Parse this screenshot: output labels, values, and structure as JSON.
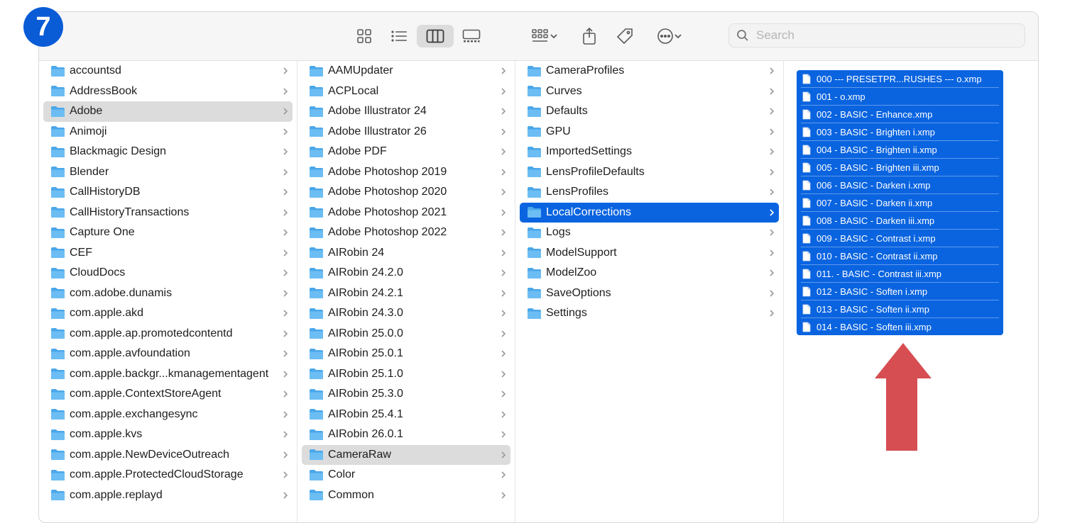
{
  "step_badge": "7",
  "toolbar": {
    "search_placeholder": "Search"
  },
  "columns": {
    "col1": [
      "accountsd",
      "AddressBook",
      "Adobe",
      "Animoji",
      "Blackmagic Design",
      "Blender",
      "CallHistoryDB",
      "CallHistoryTransactions",
      "Capture One",
      "CEF",
      "CloudDocs",
      "com.adobe.dunamis",
      "com.apple.akd",
      "com.apple.ap.promotedcontentd",
      "com.apple.avfoundation",
      "com.apple.backgr...kmanagementagent",
      "com.apple.ContextStoreAgent",
      "com.apple.exchangesync",
      "com.apple.kvs",
      "com.apple.NewDeviceOutreach",
      "com.apple.ProtectedCloudStorage",
      "com.apple.replayd"
    ],
    "col1_selected": "Adobe",
    "col2": [
      "AAMUpdater",
      "ACPLocal",
      "Adobe Illustrator 24",
      "Adobe Illustrator 26",
      "Adobe PDF",
      "Adobe Photoshop 2019",
      "Adobe Photoshop 2020",
      "Adobe Photoshop 2021",
      "Adobe Photoshop 2022",
      "AIRobin 24",
      "AIRobin 24.2.0",
      "AIRobin 24.2.1",
      "AIRobin 24.3.0",
      "AIRobin 25.0.0",
      "AIRobin 25.0.1",
      "AIRobin 25.1.0",
      "AIRobin 25.3.0",
      "AIRobin 25.4.1",
      "AIRobin 26.0.1",
      "CameraRaw",
      "Color",
      "Common"
    ],
    "col2_selected": "CameraRaw",
    "col3": [
      "CameraProfiles",
      "Curves",
      "Defaults",
      "GPU",
      "ImportedSettings",
      "LensProfileDefaults",
      "LensProfiles",
      "LocalCorrections",
      "Logs",
      "ModelSupport",
      "ModelZoo",
      "SaveOptions",
      "Settings"
    ],
    "col3_selected": "LocalCorrections",
    "files": [
      "000 --- PRESETPR...RUSHES --- o.xmp",
      "001 - o.xmp",
      "002 - BASIC - Enhance.xmp",
      "003 - BASIC - Brighten i.xmp",
      "004 - BASIC - Brighten ii.xmp",
      "005 - BASIC - Brighten iii.xmp",
      "006 - BASIC - Darken i.xmp",
      "007 - BASIC - Darken ii.xmp",
      "008 - BASIC - Darken iii.xmp",
      "009 - BASIC - Contrast i.xmp",
      "010 - BASIC - Contrast ii.xmp",
      "011. - BASIC - Contrast iii.xmp",
      "012 - BASIC - Soften i.xmp",
      "013 - BASIC - Soften ii.xmp",
      "014 - BASIC - Soften iii.xmp"
    ]
  },
  "colors": {
    "folder": "#5cb2ee",
    "selection_blue": "#0a64e0",
    "selection_gray": "#dcdcdc",
    "arrow": "#d64e52",
    "badge": "#0a5bd6"
  }
}
